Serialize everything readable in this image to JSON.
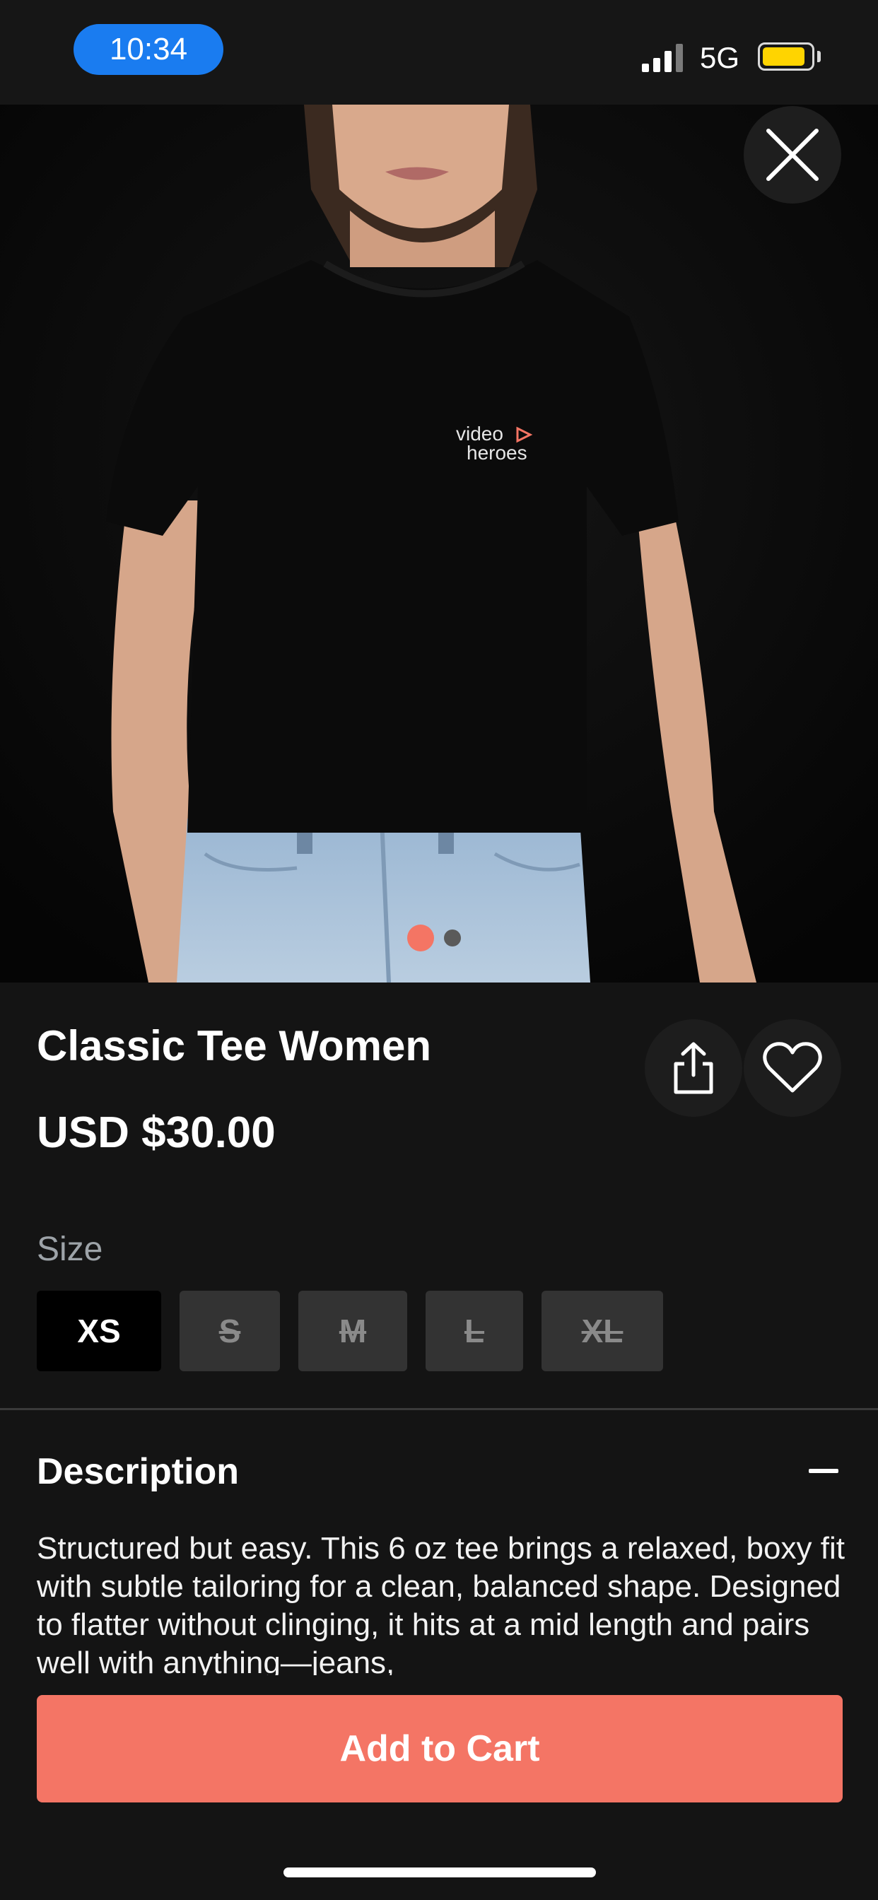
{
  "status_bar": {
    "time": "10:34",
    "network": "5G",
    "signal_icon": "signal-bars-icon",
    "battery_icon": "battery-icon",
    "battery_level": 0.9,
    "time_pill_color": "#1a7cf0",
    "battery_color": "#ffd400"
  },
  "hero": {
    "close_icon": "close-icon",
    "shirt_logo_line1": "video",
    "shirt_logo_line2": "heroes",
    "pagination": {
      "total": 2,
      "current": 1
    }
  },
  "product": {
    "title": "Classic Tee Women",
    "price": "USD $30.00",
    "share_icon": "share-icon",
    "favorite_icon": "heart-icon"
  },
  "size": {
    "label": "Size",
    "options": [
      {
        "label": "XS",
        "selected": true,
        "available": true
      },
      {
        "label": "S",
        "selected": false,
        "available": false
      },
      {
        "label": "M",
        "selected": false,
        "available": false
      },
      {
        "label": "L",
        "selected": false,
        "available": false
      },
      {
        "label": "XL",
        "selected": false,
        "available": false
      }
    ]
  },
  "description": {
    "title": "Description",
    "toggle_icon": "minus-icon",
    "text": "Structured but easy. This 6 oz tee brings a relaxed, boxy fit with subtle tailoring for a clean, balanced shape. Designed to flatter without clinging, it hits at a mid length and pairs well with anything—jeans,"
  },
  "cart": {
    "label": "Add to Cart",
    "color": "#f47565"
  },
  "colors": {
    "accent": "#f47565",
    "background": "#141414"
  }
}
